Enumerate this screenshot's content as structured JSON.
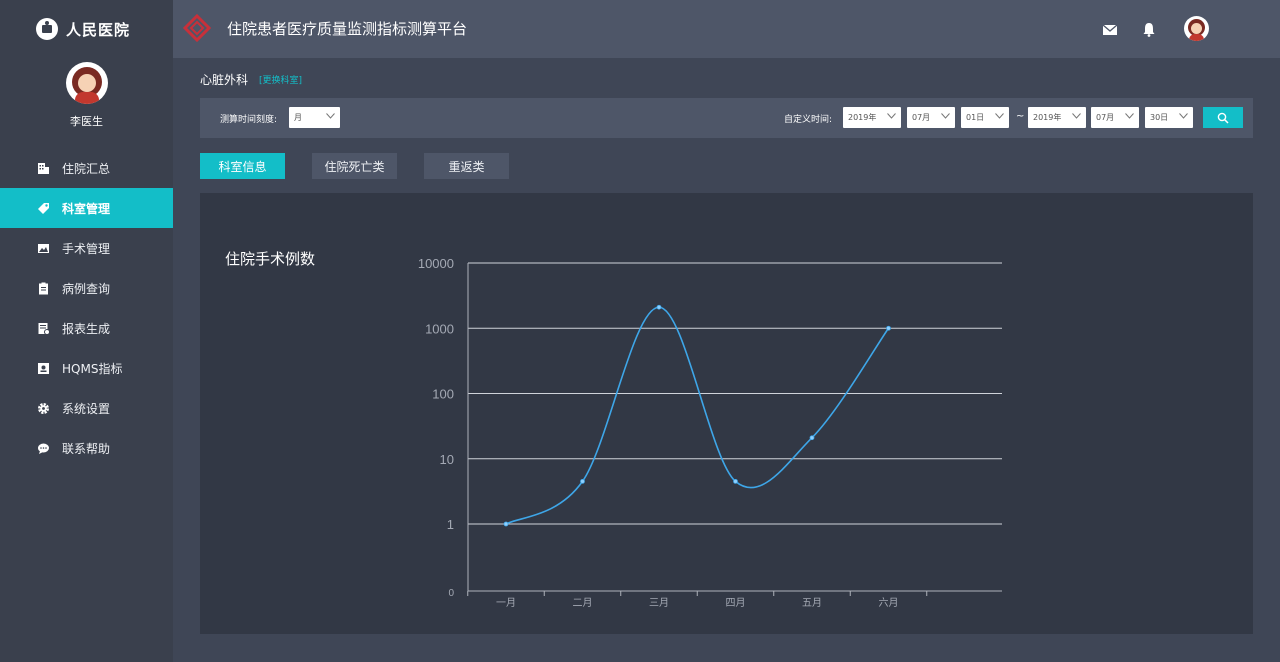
{
  "sidebar": {
    "brand": "人民医院",
    "user_name": "李医生",
    "items": [
      {
        "label": "住院汇总",
        "icon": "building-icon",
        "active": false
      },
      {
        "label": "科室管理",
        "icon": "tag-icon",
        "active": true
      },
      {
        "label": "手术管理",
        "icon": "image-icon",
        "active": false
      },
      {
        "label": "病例查询",
        "icon": "clipboard-icon",
        "active": false
      },
      {
        "label": "报表生成",
        "icon": "report-icon",
        "active": false
      },
      {
        "label": "HQMS指标",
        "icon": "badge-icon",
        "active": false
      },
      {
        "label": "系统设置",
        "icon": "gear-icon",
        "active": false
      },
      {
        "label": "联系帮助",
        "icon": "chat-icon",
        "active": false
      }
    ]
  },
  "header": {
    "title": "住院患者医疗质量监测指标测算平台",
    "icons": [
      "mail-icon",
      "bell-icon",
      "avatar"
    ]
  },
  "department": {
    "name": "心脏外科",
    "change_link": "[更换科室]"
  },
  "filters": {
    "scale_label": "测算时间刻度:",
    "scale_value": "月",
    "custom_label": "自定义时间:",
    "start": {
      "year": "2019年",
      "month": "07月",
      "day": "01日"
    },
    "separator": "~",
    "end": {
      "year": "2019年",
      "month": "07月",
      "day": "30日"
    }
  },
  "tabs": [
    {
      "label": "科室信息",
      "active": true
    },
    {
      "label": "住院死亡类",
      "active": false
    },
    {
      "label": "重返类",
      "active": false
    }
  ],
  "colors": {
    "accent": "#13bec8",
    "line": "#3ea6e8",
    "sidebar": "#3a404d",
    "header": "#4e5668",
    "panel": "#323845"
  },
  "chart_data": {
    "type": "line",
    "title": "住院手术例数",
    "categories": [
      "一月",
      "二月",
      "三月",
      "四月",
      "五月",
      "六月"
    ],
    "values": [
      1,
      4.5,
      2100,
      4.5,
      21,
      1000
    ],
    "y_scale": "log",
    "y_ticks": [
      "0",
      "1",
      "10",
      "100",
      "1000",
      "10000"
    ],
    "ylim": [
      1,
      10000
    ],
    "smooth": true,
    "grid": true,
    "legend": "none"
  }
}
